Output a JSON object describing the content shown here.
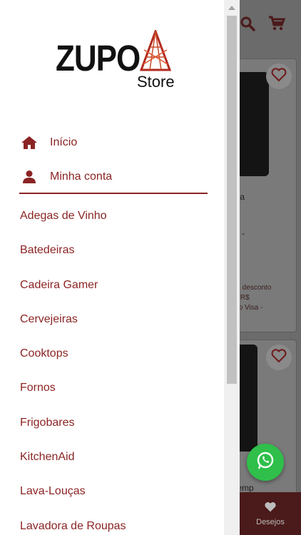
{
  "brand": {
    "name": "ZUPO",
    "sub": "Store",
    "accent": "#8b2424"
  },
  "drawer": {
    "top_items": [
      {
        "label": "Início",
        "icon": "home-icon"
      },
      {
        "label": "Minha conta",
        "icon": "user-icon"
      }
    ],
    "categories": [
      "Adegas de Vinho",
      "Batedeiras",
      "Cadeira Gamer",
      "Cervejeiras",
      "Cooktops",
      "Fornos",
      "Frigobares",
      "KitchenAid",
      "Lava-Louças",
      "Lavadora de Roupas"
    ]
  },
  "background": {
    "card1_lines": [
      "gua",
      "ar",
      "za -"
    ],
    "card1_small_lines": [
      "om desconto",
      "de R$",
      "rtão Visa -"
    ],
    "card2_lines": [
      "s",
      "stemp"
    ],
    "bottom_bar_label": "Desejos",
    "header_icons": [
      "search-icon",
      "cart-icon"
    ]
  }
}
